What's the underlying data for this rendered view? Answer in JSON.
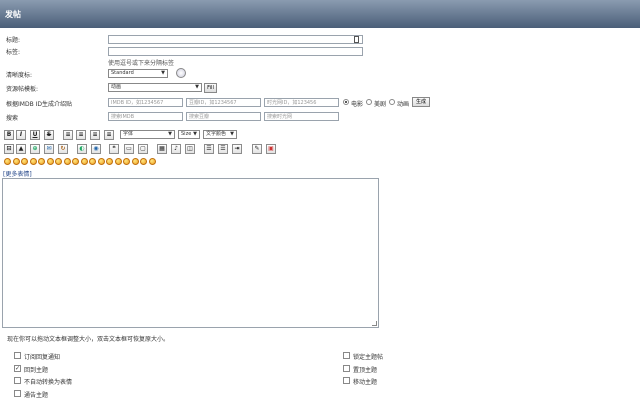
{
  "page": {
    "title": "发帖"
  },
  "form": {
    "title_label": "标题:",
    "tags_label": "标签:",
    "tags_hint": "使用逗号或下来分隔标签",
    "quality_label": "清晰度标:",
    "quality_value": "Standard",
    "template_label": "资源帖模板:",
    "template_value": "动画",
    "fill_button": "Fill",
    "imdb_label": "根据IMDB ID生成介绍贴",
    "imdb_placeholder": "IMDB ID，如1234567",
    "douban_placeholder": "豆瓣ID，如1234567",
    "shiguang_placeholder": "时光网ID，如123456",
    "type_options": [
      "电影",
      "美剧",
      "动画"
    ],
    "generate_button": "生成",
    "search_label": "搜索",
    "search_imdb_placeholder": "搜索IMDB",
    "search_douban_placeholder": "搜索豆瓣",
    "search_shiguang_placeholder": "搜索时光网"
  },
  "editor": {
    "toolbar_row1": [
      "B",
      "I",
      "U",
      "S"
    ],
    "font_select": "字体",
    "size_select": "Size",
    "color_select": "文字颜色",
    "more_smilies": "[更多表情]",
    "resize_hint": "现在你可以拖动文本框调整大小，双击文本框可恢复原大小。",
    "smiley_count": 18
  },
  "options": {
    "left": [
      {
        "label": "订阅回复通知",
        "checked": false
      },
      {
        "label": "回到主题",
        "checked": true
      },
      {
        "label": "不自动转换为表情",
        "checked": false
      },
      {
        "label": "通告主题",
        "checked": false
      }
    ],
    "right": [
      {
        "label": "锁定主题帖",
        "checked": false
      },
      {
        "label": "置顶主题",
        "checked": false
      },
      {
        "label": "移动主题",
        "checked": false
      }
    ]
  },
  "colors": {
    "header_top": "#8a9bb0",
    "header_bottom": "#4a5e78"
  },
  "icons": [
    "image-icon",
    "link-icon",
    "quote-icon",
    "code-icon",
    "list-icon",
    "table-icon",
    "flash-icon",
    "smiley-icon"
  ]
}
